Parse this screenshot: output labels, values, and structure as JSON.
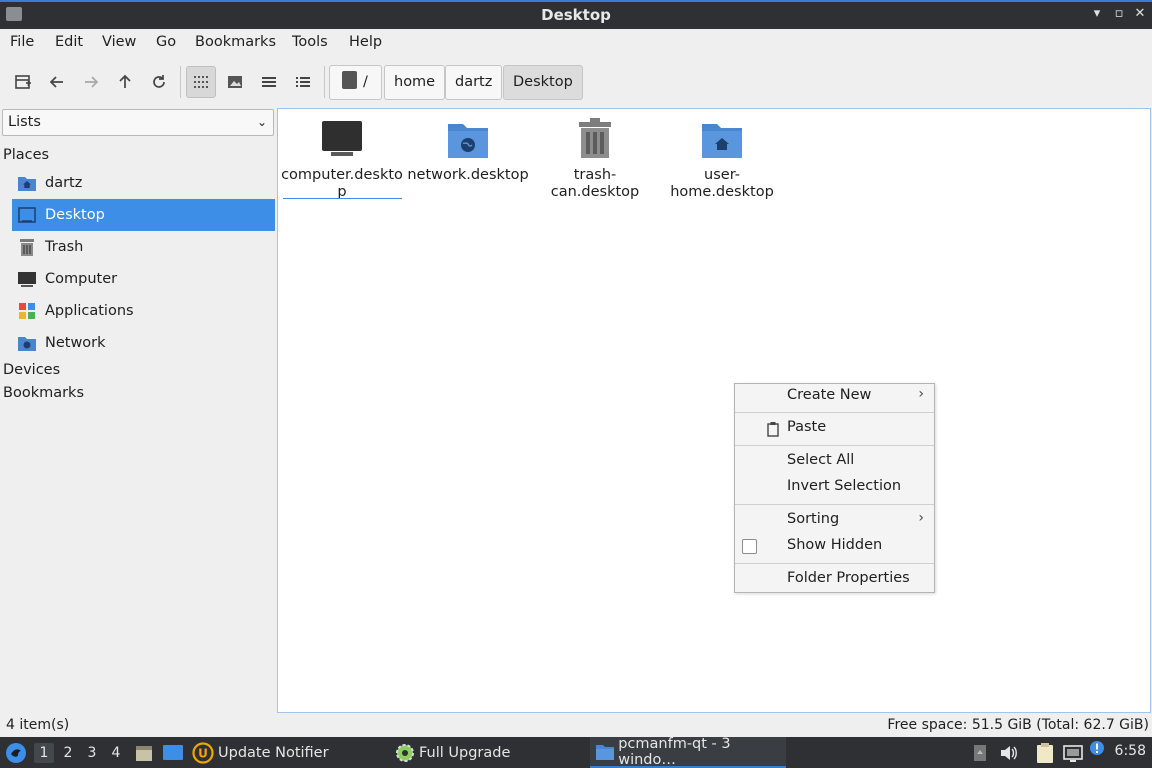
{
  "window": {
    "title": "Desktop"
  },
  "menubar": [
    "File",
    "Edit",
    "View",
    "Go",
    "Bookmarks",
    "Tools",
    "Help"
  ],
  "breadcrumb": [
    "/",
    "home",
    "dartz",
    "Desktop"
  ],
  "sidebar": {
    "mode": "Lists",
    "places_label": "Places",
    "places": [
      {
        "label": "dartz",
        "icon": "user-home-icon"
      },
      {
        "label": "Desktop",
        "icon": "desktop-icon"
      },
      {
        "label": "Trash",
        "icon": "trash-icon"
      },
      {
        "label": "Computer",
        "icon": "computer-icon"
      },
      {
        "label": "Applications",
        "icon": "applications-icon"
      },
      {
        "label": "Network",
        "icon": "network-icon"
      }
    ],
    "devices_label": "Devices",
    "bookmarks_label": "Bookmarks"
  },
  "files": [
    {
      "name": "computer.desktop",
      "icon": "computer-icon"
    },
    {
      "name": "network.desktop",
      "icon": "network-folder-icon"
    },
    {
      "name": "trash-can.desktop",
      "icon": "trash-icon"
    },
    {
      "name": "user-home.desktop",
      "icon": "home-folder-icon"
    }
  ],
  "context_menu": {
    "create_new": "Create New",
    "paste": "Paste",
    "select_all": "Select All",
    "invert_selection": "Invert Selection",
    "sorting": "Sorting",
    "show_hidden": "Show Hidden",
    "folder_properties": "Folder Properties"
  },
  "status": {
    "items": "4 item(s)",
    "free_space": "Free space: 51.5 GiB (Total: 62.7 GiB)"
  },
  "taskbar": {
    "workspaces": [
      "1",
      "2",
      "3",
      "4"
    ],
    "tasks": [
      "Update Notifier",
      "Full Upgrade",
      "pcmanfm-qt - 3 windo…"
    ],
    "clock": "6:58"
  },
  "colors": {
    "accent": "#3d8ee6",
    "folder": "#4a86d0",
    "titlebar": "#2e3033"
  }
}
